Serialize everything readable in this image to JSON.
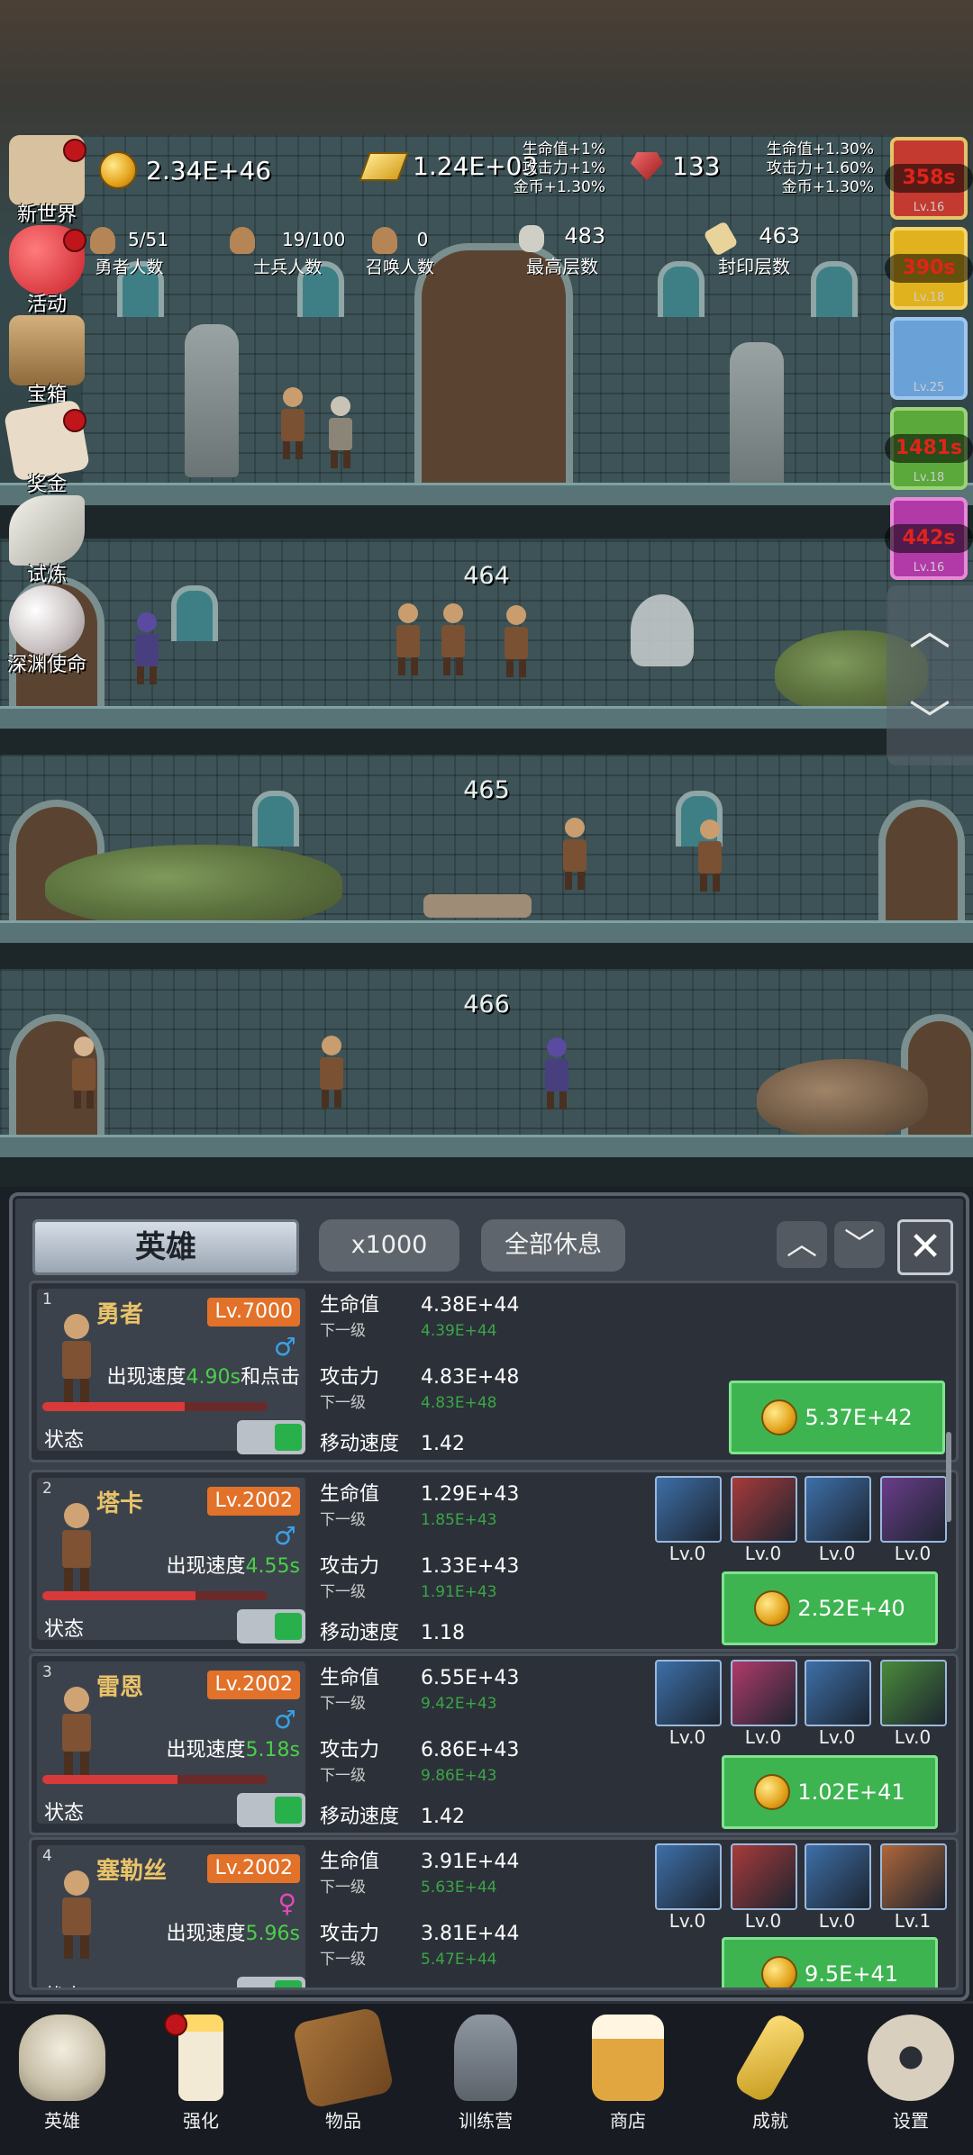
{
  "resources": {
    "gold": "2.34E+46",
    "goldbar": "1.24E+03",
    "gem": "133"
  },
  "bonus_left": [
    "生命值+1%",
    "攻击力+1%",
    "金币+1.30%"
  ],
  "bonus_right": [
    "生命值+1.30%",
    "攻击力+1.60%",
    "金币+1.30%"
  ],
  "counts": [
    {
      "value": "5/51",
      "label": "勇者人数"
    },
    {
      "value": "19/100",
      "label": "士兵人数"
    },
    {
      "value": "0",
      "label": "召唤人数"
    },
    {
      "value": "483",
      "label": "最高层数"
    },
    {
      "value": "463",
      "label": "封印层数"
    }
  ],
  "side_menu": [
    {
      "label": "新世界",
      "icon": "map-scroll-icon",
      "dot": true
    },
    {
      "label": "活动",
      "icon": "heart-icon",
      "dot": true
    },
    {
      "label": "宝箱",
      "icon": "treasure-chest-icon",
      "dot": false
    },
    {
      "label": "奖金",
      "icon": "envelope-icon",
      "dot": true
    },
    {
      "label": "试炼",
      "icon": "feather-icon",
      "dot": false
    },
    {
      "label": "深渊使命",
      "icon": "pearl-icon",
      "dot": false
    }
  ],
  "buffs": [
    {
      "timer": "358s",
      "level": "Lv.16",
      "color": "#c43a30"
    },
    {
      "timer": "390s",
      "level": "Lv.18",
      "color": "#e0b21e"
    },
    {
      "timer": "",
      "level": "Lv.25",
      "color": "#6aa2d8"
    },
    {
      "timer": "1481s",
      "level": "Lv.18",
      "color": "#5aa93a"
    },
    {
      "timer": "442s",
      "level": "Lv.16",
      "color": "#b23aa8"
    }
  ],
  "floors": [
    "464",
    "465",
    "466"
  ],
  "panel": {
    "title": "英雄",
    "multiplier": "x1000",
    "rest_all": "全部休息",
    "up_icon": "chevron-up-icon",
    "down_icon": "chevron-down-icon",
    "close_icon": "close-icon"
  },
  "labels": {
    "hp": "生命值",
    "atk": "攻击力",
    "next": "下一级",
    "move": "移动速度",
    "state": "状态",
    "speed_prefix": "出现速度",
    "click_suffix": "和点击"
  },
  "heroes": [
    {
      "idx": "1",
      "name": "勇者",
      "level": "Lv.7000",
      "gender": "♂",
      "gender_color": "#3aa0e8",
      "speed": "4.90s",
      "click": true,
      "hp_frac": 0.63,
      "hp": "4.38E+44",
      "hp_next": "4.39E+44",
      "atk": "4.83E+48",
      "atk_next": "4.83E+48",
      "move": "1.42",
      "cost": "5.37E+42",
      "skills": []
    },
    {
      "idx": "2",
      "name": "塔卡",
      "level": "Lv.2002",
      "gender": "♂",
      "gender_color": "#3aa0e8",
      "speed": "4.55s",
      "click": false,
      "hp_frac": 0.68,
      "hp": "1.29E+43",
      "hp_next": "1.85E+43",
      "atk": "1.33E+43",
      "atk_next": "1.91E+43",
      "move": "1.18",
      "cost": "2.52E+40",
      "skills": [
        {
          "icon": "axe-icon",
          "level": "Lv.0",
          "color": "#3d6fa8"
        },
        {
          "icon": "cleave-icon",
          "level": "Lv.0",
          "color": "#a83a3a"
        },
        {
          "icon": "boot-icon",
          "level": "Lv.0",
          "color": "#3d6fa8"
        },
        {
          "icon": "gauntlet-icon",
          "level": "Lv.0",
          "color": "#6a3d8a"
        }
      ]
    },
    {
      "idx": "3",
      "name": "雷恩",
      "level": "Lv.2002",
      "gender": "♂",
      "gender_color": "#3aa0e8",
      "speed": "5.18s",
      "click": false,
      "hp_frac": 0.6,
      "hp": "6.55E+43",
      "hp_next": "9.42E+43",
      "atk": "6.86E+43",
      "atk_next": "9.86E+43",
      "move": "1.42",
      "cost": "1.02E+41",
      "skills": [
        {
          "icon": "sword-icon",
          "level": "Lv.0",
          "color": "#3d6fa8"
        },
        {
          "icon": "blade-icon",
          "level": "Lv.0",
          "color": "#b03a6a"
        },
        {
          "icon": "boot-icon",
          "level": "Lv.0",
          "color": "#3d6fa8"
        },
        {
          "icon": "serpent-icon",
          "level": "Lv.0",
          "color": "#4a8a3a"
        }
      ]
    },
    {
      "idx": "4",
      "name": "塞勒丝",
      "level": "Lv.2002",
      "gender": "♀",
      "gender_color": "#e04ab8",
      "speed": "5.96s",
      "click": false,
      "hp_frac": 0.0,
      "hp": "3.91E+44",
      "hp_next": "5.63E+44",
      "atk": "3.81E+44",
      "atk_next": "5.47E+44",
      "move": "",
      "cost": "9.5E+41",
      "skills": [
        {
          "icon": "shield-icon",
          "level": "Lv.0",
          "color": "#3d6fa8"
        },
        {
          "icon": "fang-icon",
          "level": "Lv.0",
          "color": "#a83a3a"
        },
        {
          "icon": "greave-icon",
          "level": "Lv.0",
          "color": "#3d6fa8"
        },
        {
          "icon": "sword-altar-icon",
          "level": "Lv.1",
          "color": "#b0663a"
        }
      ]
    }
  ],
  "nav": [
    {
      "label": "英雄",
      "icon": "skull-icon",
      "dot": false
    },
    {
      "label": "强化",
      "icon": "candle-icon",
      "dot": true
    },
    {
      "label": "物品",
      "icon": "book-icon",
      "dot": false
    },
    {
      "label": "训练营",
      "icon": "lantern-icon",
      "dot": false
    },
    {
      "label": "商店",
      "icon": "beer-mug-icon",
      "dot": false
    },
    {
      "label": "成就",
      "icon": "key-icon",
      "dot": false
    },
    {
      "label": "设置",
      "icon": "gear-icon",
      "dot": false
    }
  ]
}
